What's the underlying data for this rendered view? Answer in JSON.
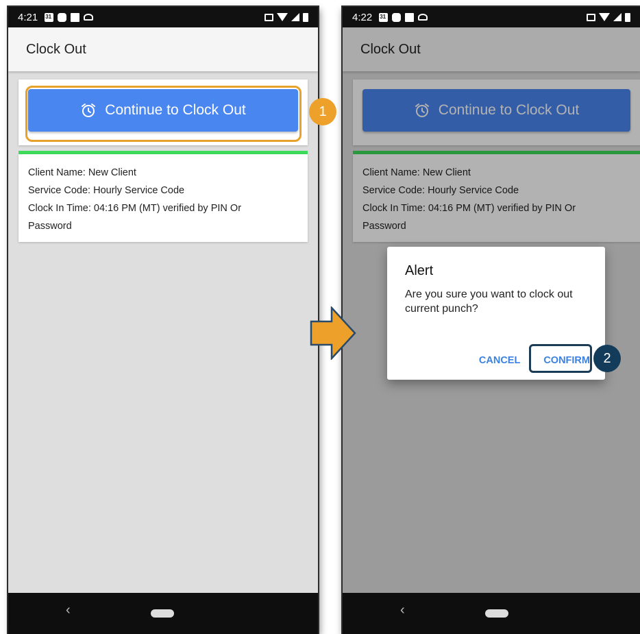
{
  "screens": [
    {
      "status_time": "4:21",
      "app_title": "Clock Out",
      "clock_out_button": "Continue to Clock Out",
      "info": {
        "client_name": "Client Name: New Client",
        "service_code": "Service Code: Hourly Service Code",
        "clock_in_time": "Clock In Time: 04:16 PM (MT) verified by PIN Or",
        "clock_in_time_cont": "Password"
      }
    },
    {
      "status_time": "4:22",
      "app_title": "Clock Out",
      "clock_out_button": "Continue to Clock Out",
      "info": {
        "client_name": "Client Name: New Client",
        "service_code": "Service Code: Hourly Service Code",
        "clock_in_time": "Clock In Time: 04:16 PM (MT) verified by PIN Or",
        "clock_in_time_cont": "Password"
      },
      "dialog": {
        "title": "Alert",
        "message": "Are you sure you want to clock out current punch?",
        "cancel": "CANCEL",
        "confirm": "CONFIRM"
      }
    }
  ],
  "steps": [
    "1",
    "2"
  ],
  "colors": {
    "primary_button": "#4a86f0",
    "accent_green": "#3ddc5a",
    "step1": "#eda02a",
    "step2": "#133c5a",
    "dialog_action": "#3a82e0"
  },
  "nav": {
    "back_glyph": "‹"
  }
}
